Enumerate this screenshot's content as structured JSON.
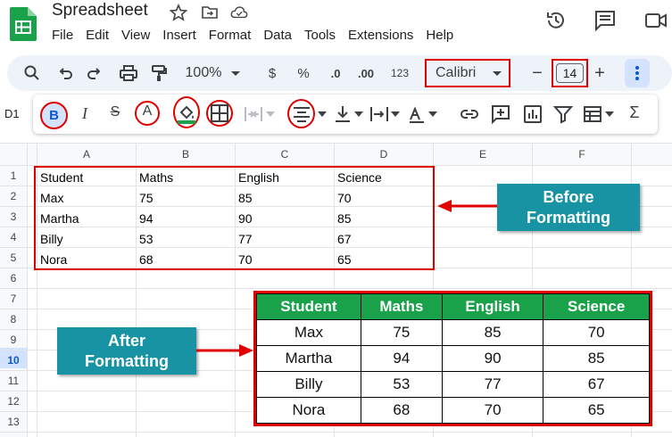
{
  "app": {
    "title": "Spreadsheet",
    "menu": [
      "File",
      "Edit",
      "View",
      "Insert",
      "Format",
      "Data",
      "Tools",
      "Extensions",
      "Help"
    ]
  },
  "toolbar": {
    "zoom": "100%",
    "currency": "$",
    "percent": "%",
    "dec_decrease": ".0",
    "dec_increase": ".00",
    "number_format": "123",
    "font": "Calibri",
    "font_size": "14",
    "minus": "−",
    "plus": "+"
  },
  "name_box": "D1",
  "columns": [
    "A",
    "B",
    "C",
    "D",
    "E",
    "F"
  ],
  "rows": [
    "1",
    "2",
    "3",
    "4",
    "5",
    "6",
    "7",
    "8",
    "9",
    "10",
    "11",
    "12",
    "13"
  ],
  "before": {
    "header": [
      "Student",
      "Maths",
      "English",
      "Science"
    ],
    "rows": [
      [
        "Max",
        "75",
        "85",
        "70"
      ],
      [
        "Martha",
        "94",
        "90",
        "85"
      ],
      [
        "Billy",
        "53",
        "77",
        "67"
      ],
      [
        "Nora",
        "68",
        "70",
        "65"
      ]
    ]
  },
  "after": {
    "header": [
      "Student",
      "Maths",
      "English",
      "Science"
    ],
    "rows": [
      [
        "Max",
        "75",
        "85",
        "70"
      ],
      [
        "Martha",
        "94",
        "90",
        "85"
      ],
      [
        "Billy",
        "53",
        "77",
        "67"
      ],
      [
        "Nora",
        "68",
        "70",
        "65"
      ]
    ]
  },
  "callouts": {
    "before_l1": "Before",
    "before_l2": "Formatting",
    "after_l1": "After",
    "after_l2": "Formatting"
  },
  "colors": {
    "accent_red": "#e00000",
    "header_green": "#1aa24a",
    "callout_teal": "#1793a3",
    "toolbar_bg": "#eef2f9"
  },
  "icons": {
    "logo": "sheets-logo-icon",
    "star": "star-icon",
    "move": "move-to-folder-icon",
    "cloud": "cloud-saved-icon",
    "history": "version-history-icon",
    "comments": "comment-icon"
  }
}
